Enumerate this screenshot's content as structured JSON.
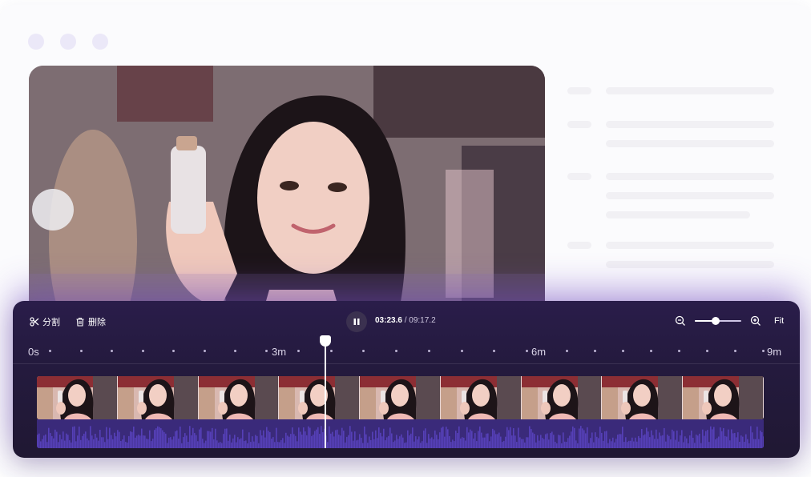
{
  "toolbar": {
    "split_label": "分割",
    "delete_label": "删除",
    "current_time": "03:23.6",
    "separator": "/",
    "total_time": "09:17.2",
    "fit_label": "Fit",
    "zoom_level": 0.45
  },
  "ruler": {
    "labels": [
      "0s",
      "3m",
      "6m",
      "9m"
    ]
  },
  "playhead": {
    "time": "03:23.6"
  },
  "colors": {
    "timeline_bg": "#241a3e",
    "waveform": "#5640b8",
    "accent": "#ffffff"
  },
  "icons": [
    "window-dot",
    "scissors-icon",
    "trash-icon",
    "pause-icon",
    "zoom-out-icon",
    "zoom-in-icon"
  ]
}
